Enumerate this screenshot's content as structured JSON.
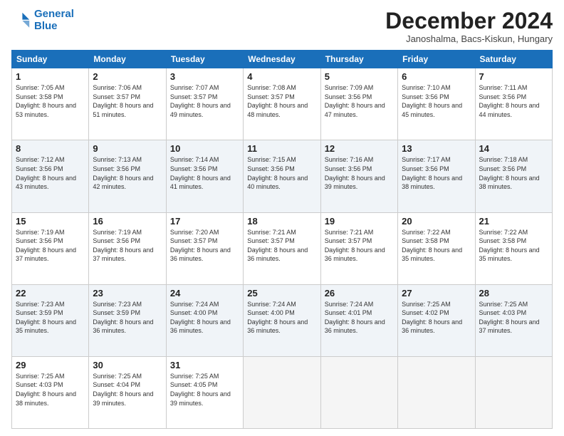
{
  "logo": {
    "line1": "General",
    "line2": "Blue"
  },
  "title": "December 2024",
  "subtitle": "Janoshalma, Bacs-Kiskun, Hungary",
  "days_header": [
    "Sunday",
    "Monday",
    "Tuesday",
    "Wednesday",
    "Thursday",
    "Friday",
    "Saturday"
  ],
  "weeks": [
    [
      {
        "day": "1",
        "sunrise": "7:05 AM",
        "sunset": "3:58 PM",
        "daylight": "8 hours and 53 minutes."
      },
      {
        "day": "2",
        "sunrise": "7:06 AM",
        "sunset": "3:57 PM",
        "daylight": "8 hours and 51 minutes."
      },
      {
        "day": "3",
        "sunrise": "7:07 AM",
        "sunset": "3:57 PM",
        "daylight": "8 hours and 49 minutes."
      },
      {
        "day": "4",
        "sunrise": "7:08 AM",
        "sunset": "3:57 PM",
        "daylight": "8 hours and 48 minutes."
      },
      {
        "day": "5",
        "sunrise": "7:09 AM",
        "sunset": "3:56 PM",
        "daylight": "8 hours and 47 minutes."
      },
      {
        "day": "6",
        "sunrise": "7:10 AM",
        "sunset": "3:56 PM",
        "daylight": "8 hours and 45 minutes."
      },
      {
        "day": "7",
        "sunrise": "7:11 AM",
        "sunset": "3:56 PM",
        "daylight": "8 hours and 44 minutes."
      }
    ],
    [
      {
        "day": "8",
        "sunrise": "7:12 AM",
        "sunset": "3:56 PM",
        "daylight": "8 hours and 43 minutes."
      },
      {
        "day": "9",
        "sunrise": "7:13 AM",
        "sunset": "3:56 PM",
        "daylight": "8 hours and 42 minutes."
      },
      {
        "day": "10",
        "sunrise": "7:14 AM",
        "sunset": "3:56 PM",
        "daylight": "8 hours and 41 minutes."
      },
      {
        "day": "11",
        "sunrise": "7:15 AM",
        "sunset": "3:56 PM",
        "daylight": "8 hours and 40 minutes."
      },
      {
        "day": "12",
        "sunrise": "7:16 AM",
        "sunset": "3:56 PM",
        "daylight": "8 hours and 39 minutes."
      },
      {
        "day": "13",
        "sunrise": "7:17 AM",
        "sunset": "3:56 PM",
        "daylight": "8 hours and 38 minutes."
      },
      {
        "day": "14",
        "sunrise": "7:18 AM",
        "sunset": "3:56 PM",
        "daylight": "8 hours and 38 minutes."
      }
    ],
    [
      {
        "day": "15",
        "sunrise": "7:19 AM",
        "sunset": "3:56 PM",
        "daylight": "8 hours and 37 minutes."
      },
      {
        "day": "16",
        "sunrise": "7:19 AM",
        "sunset": "3:56 PM",
        "daylight": "8 hours and 37 minutes."
      },
      {
        "day": "17",
        "sunrise": "7:20 AM",
        "sunset": "3:57 PM",
        "daylight": "8 hours and 36 minutes."
      },
      {
        "day": "18",
        "sunrise": "7:21 AM",
        "sunset": "3:57 PM",
        "daylight": "8 hours and 36 minutes."
      },
      {
        "day": "19",
        "sunrise": "7:21 AM",
        "sunset": "3:57 PM",
        "daylight": "8 hours and 36 minutes."
      },
      {
        "day": "20",
        "sunrise": "7:22 AM",
        "sunset": "3:58 PM",
        "daylight": "8 hours and 35 minutes."
      },
      {
        "day": "21",
        "sunrise": "7:22 AM",
        "sunset": "3:58 PM",
        "daylight": "8 hours and 35 minutes."
      }
    ],
    [
      {
        "day": "22",
        "sunrise": "7:23 AM",
        "sunset": "3:59 PM",
        "daylight": "8 hours and 35 minutes."
      },
      {
        "day": "23",
        "sunrise": "7:23 AM",
        "sunset": "3:59 PM",
        "daylight": "8 hours and 36 minutes."
      },
      {
        "day": "24",
        "sunrise": "7:24 AM",
        "sunset": "4:00 PM",
        "daylight": "8 hours and 36 minutes."
      },
      {
        "day": "25",
        "sunrise": "7:24 AM",
        "sunset": "4:00 PM",
        "daylight": "8 hours and 36 minutes."
      },
      {
        "day": "26",
        "sunrise": "7:24 AM",
        "sunset": "4:01 PM",
        "daylight": "8 hours and 36 minutes."
      },
      {
        "day": "27",
        "sunrise": "7:25 AM",
        "sunset": "4:02 PM",
        "daylight": "8 hours and 36 minutes."
      },
      {
        "day": "28",
        "sunrise": "7:25 AM",
        "sunset": "4:03 PM",
        "daylight": "8 hours and 37 minutes."
      }
    ],
    [
      {
        "day": "29",
        "sunrise": "7:25 AM",
        "sunset": "4:03 PM",
        "daylight": "8 hours and 38 minutes."
      },
      {
        "day": "30",
        "sunrise": "7:25 AM",
        "sunset": "4:04 PM",
        "daylight": "8 hours and 39 minutes."
      },
      {
        "day": "31",
        "sunrise": "7:25 AM",
        "sunset": "4:05 PM",
        "daylight": "8 hours and 39 minutes."
      },
      null,
      null,
      null,
      null
    ]
  ]
}
